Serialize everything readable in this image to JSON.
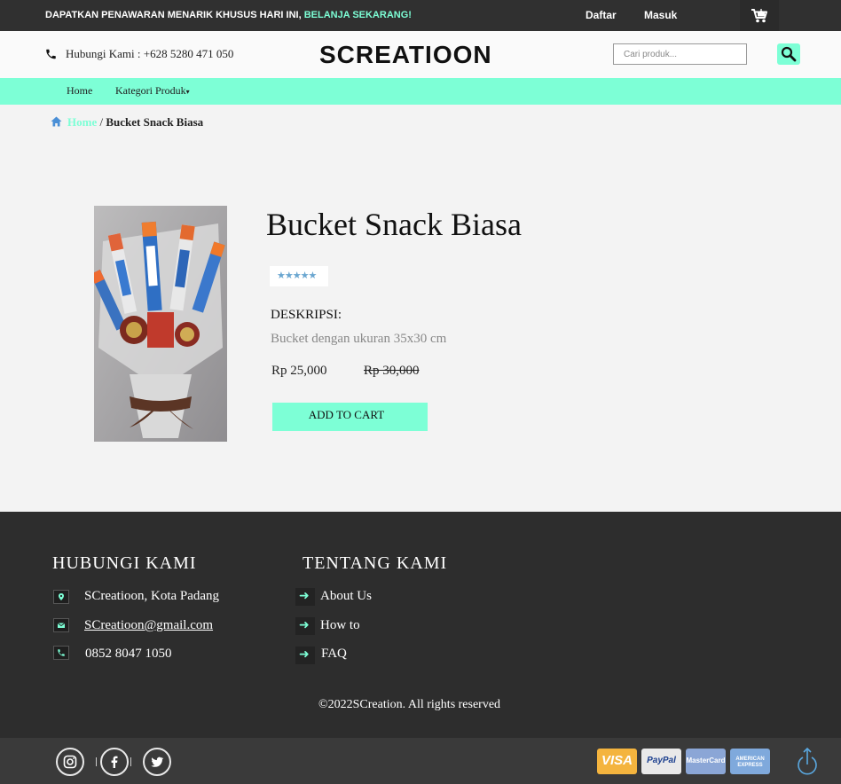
{
  "topbar": {
    "promo_text": "DAPATKAN PENAWARAN MENARIK KHUSUS HARI INI, ",
    "promo_link": "BELANJA SEKARANG!",
    "register_label": "Daftar",
    "login_label": "Masuk",
    "cart_icon": "cart-icon"
  },
  "header": {
    "contact_label": "Hubungi Kami : +628 5280 471 050",
    "logo": "SCREATIOON",
    "search_placeholder": "Cari produk...",
    "search_icon": "search-icon"
  },
  "nav": {
    "home": "Home",
    "categories": "Kategori Produk",
    "categories_caret": "▾"
  },
  "breadcrumb": {
    "home": "Home",
    "separator": " / ",
    "current": "Bucket Snack Biasa"
  },
  "product": {
    "title": "Bucket Snack Biasa",
    "rating_stars": "★★★★★",
    "rating_value": 5,
    "description_label": "DESKRIPSI:",
    "description": "Bucket dengan ukuran 35x30 cm",
    "price": "Rp 25,000",
    "old_price": "Rp 30,000",
    "add_to_cart": "ADD TO CART"
  },
  "footer": {
    "contact_heading": "HUBUNGI KAMI",
    "address": "SCreatioon, Kota Padang",
    "email": "SCreatioon@gmail.com",
    "phone": "0852 8047 1050",
    "about_heading": "TENTANG KAMI",
    "about_links": [
      "About Us",
      "How to",
      "FAQ"
    ],
    "copyright": "©2022SCreation. All rights reserved"
  },
  "bottombar": {
    "social": [
      "instagram-icon",
      "facebook-icon",
      "twitter-icon"
    ],
    "payments": {
      "visa": "VISA",
      "paypal": "PayPal",
      "mastercard": "MasterCard",
      "amex_line1": "AMERICAN",
      "amex_line2": "EXPRESS"
    }
  },
  "colors": {
    "accent": "#7dffd6",
    "topbar_bg": "#303030",
    "footer_bg": "#2d2d2d",
    "rating_stars": "#6aa6d0"
  }
}
